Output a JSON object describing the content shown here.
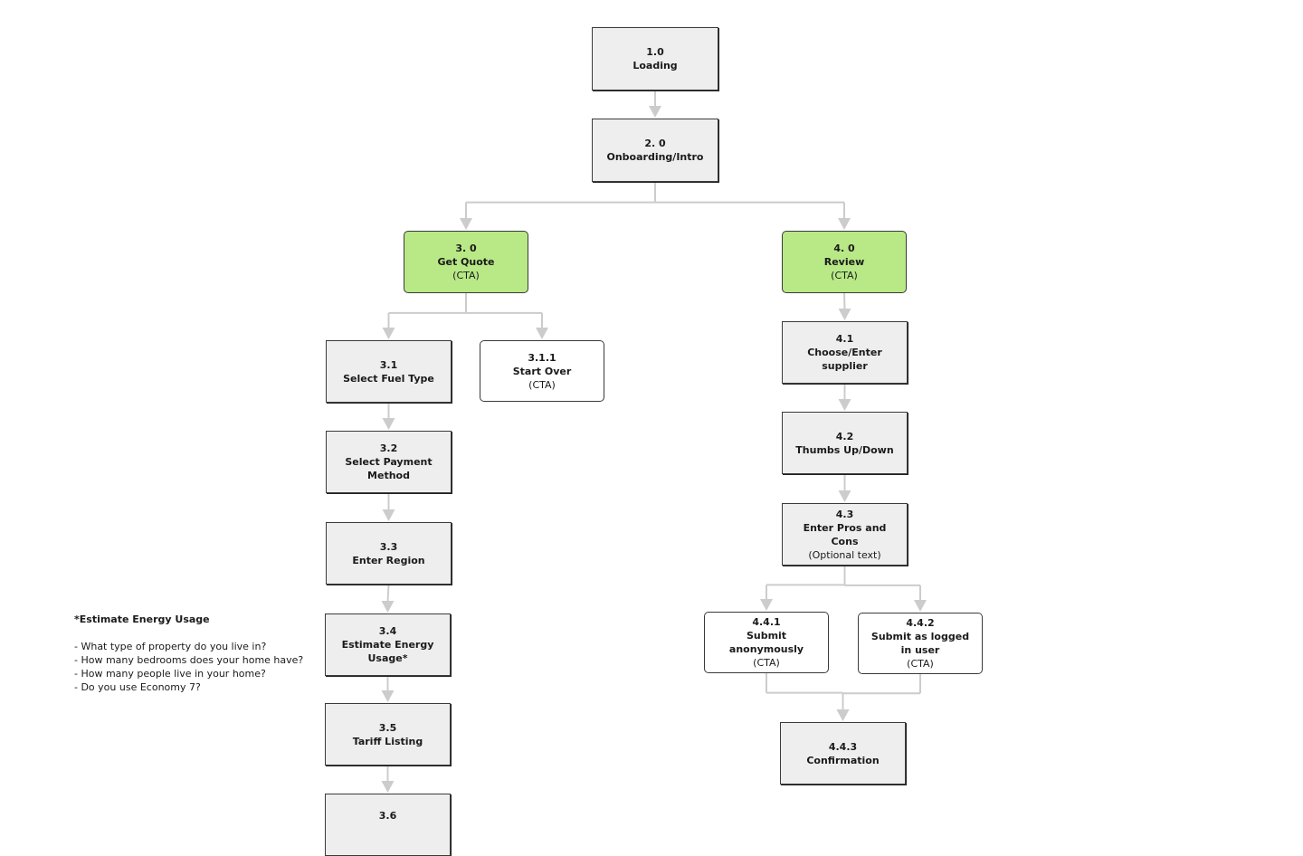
{
  "diagram": {
    "colors": {
      "screen_fill": "#eeeeee",
      "cta_fill": "#b8e986",
      "action_fill": "#ffffff",
      "connector": "#cccccc",
      "border": "#3a3a3a"
    },
    "nodes": [
      {
        "id": "n1_0",
        "num": "1.0",
        "title": "Loading",
        "sub": "",
        "kind": "screen"
      },
      {
        "id": "n2_0",
        "num": "2. 0",
        "title": "Onboarding/Intro",
        "sub": "",
        "kind": "screen"
      },
      {
        "id": "n3_0",
        "num": "3. 0",
        "title": "Get Quote",
        "sub": "(CTA)",
        "kind": "cta"
      },
      {
        "id": "n4_0",
        "num": "4. 0",
        "title": "Review",
        "sub": "(CTA)",
        "kind": "cta"
      },
      {
        "id": "n3_1",
        "num": "3.1",
        "title": "Select Fuel Type",
        "sub": "",
        "kind": "screen"
      },
      {
        "id": "n3_1_1",
        "num": "3.1.1",
        "title": "Start Over",
        "sub": "(CTA)",
        "kind": "action"
      },
      {
        "id": "n3_2",
        "num": "3.2",
        "title": "Select Payment Method",
        "sub": "",
        "kind": "screen"
      },
      {
        "id": "n3_3",
        "num": "3.3",
        "title": "Enter Region",
        "sub": "",
        "kind": "screen"
      },
      {
        "id": "n3_4",
        "num": "3.4",
        "title": "Estimate Energy Usage*",
        "sub": "",
        "kind": "screen"
      },
      {
        "id": "n3_5",
        "num": "3.5",
        "title": "Tariff Listing",
        "sub": "",
        "kind": "screen"
      },
      {
        "id": "n3_6",
        "num": "3.6",
        "title": "",
        "sub": "",
        "kind": "screen"
      },
      {
        "id": "n4_1",
        "num": "4.1",
        "title": "Choose/Enter supplier",
        "sub": "",
        "kind": "screen"
      },
      {
        "id": "n4_2",
        "num": "4.2",
        "title": "Thumbs Up/Down",
        "sub": "",
        "kind": "screen"
      },
      {
        "id": "n4_3",
        "num": "4.3",
        "title": "Enter Pros and Cons",
        "sub": "(Optional text)",
        "kind": "screen"
      },
      {
        "id": "n4_4_1",
        "num": "4.4.1",
        "title": "Submit anonymously",
        "sub": "(CTA)",
        "kind": "action"
      },
      {
        "id": "n4_4_2",
        "num": "4.4.2",
        "title": "Submit as logged in user",
        "sub": "(CTA)",
        "kind": "action"
      },
      {
        "id": "n4_4_3",
        "num": "4.4.3",
        "title": "Confirmation",
        "sub": "",
        "kind": "screen"
      }
    ],
    "edges": [
      [
        "n1_0",
        "n2_0"
      ],
      [
        "n2_0",
        "n3_0"
      ],
      [
        "n2_0",
        "n4_0"
      ],
      [
        "n3_0",
        "n3_1"
      ],
      [
        "n3_0",
        "n3_1_1"
      ],
      [
        "n3_1",
        "n3_2"
      ],
      [
        "n3_2",
        "n3_3"
      ],
      [
        "n3_3",
        "n3_4"
      ],
      [
        "n3_4",
        "n3_5"
      ],
      [
        "n3_5",
        "n3_6"
      ],
      [
        "n4_0",
        "n4_1"
      ],
      [
        "n4_1",
        "n4_2"
      ],
      [
        "n4_2",
        "n4_3"
      ],
      [
        "n4_3",
        "n4_4_1"
      ],
      [
        "n4_3",
        "n4_4_2"
      ],
      [
        "n4_4_1",
        "n4_4_3"
      ],
      [
        "n4_4_2",
        "n4_4_3"
      ]
    ]
  },
  "note": {
    "title": "*Estimate Energy Usage",
    "items": [
      "- What type of property do you live in?",
      "- How many bedrooms does your home have?",
      "- How many people live in your home?",
      "- Do you use Economy 7?"
    ]
  }
}
